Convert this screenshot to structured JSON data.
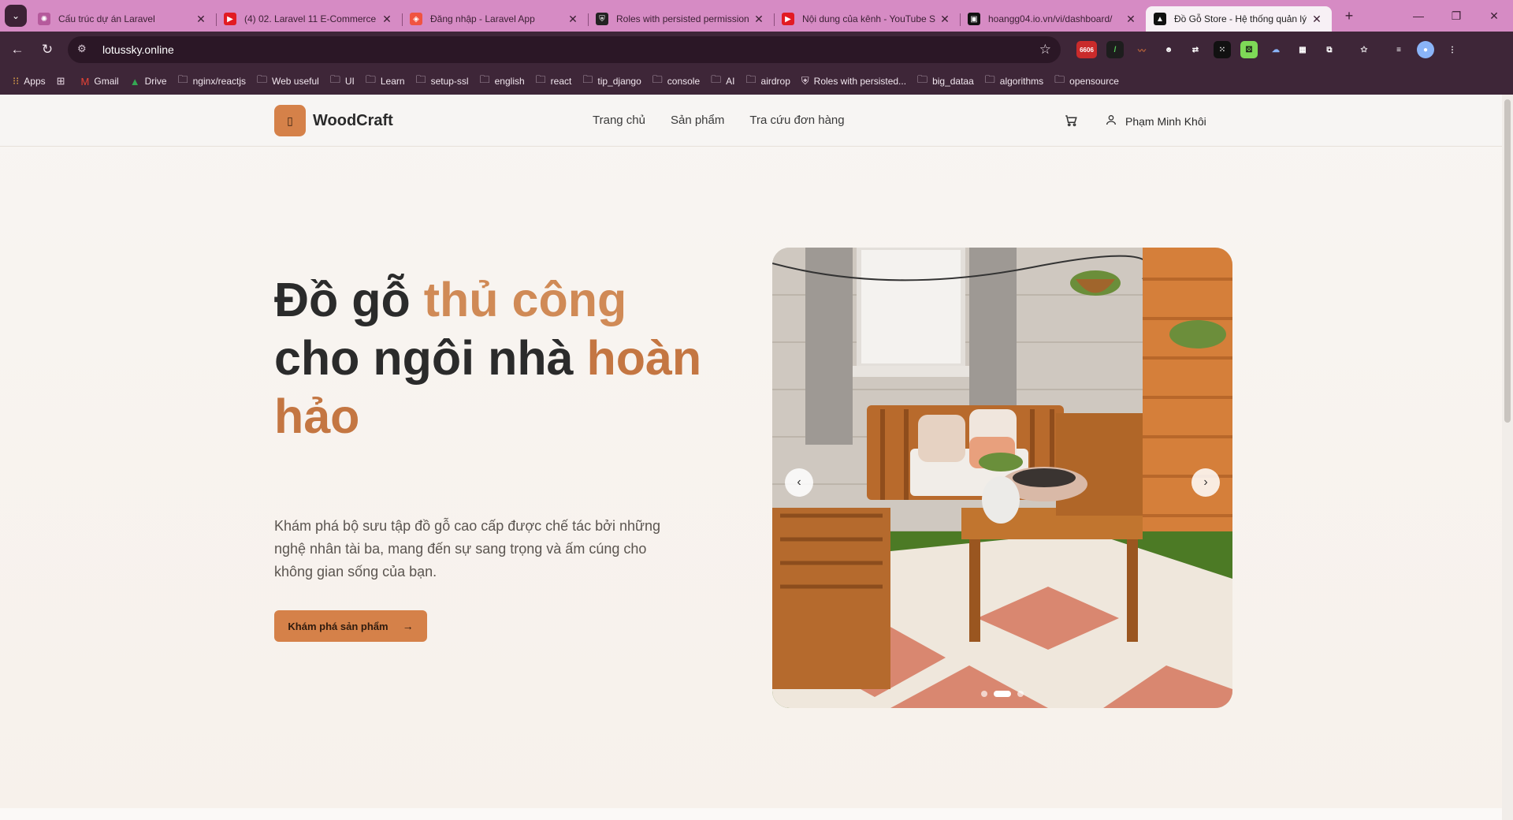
{
  "browser": {
    "tabs": [
      {
        "title": "Cấu trúc dự án Laravel",
        "icon": "openai-icon",
        "color": "#7a4a6f"
      },
      {
        "title": "(4) 02. Laravel 11 E-Commerce",
        "icon": "youtube-icon",
        "color": "#e21b23"
      },
      {
        "title": "Đăng nhập - Laravel App",
        "icon": "laravel-icon",
        "color": "#f05340"
      },
      {
        "title": "Roles with persisted permission",
        "icon": "shield-icon",
        "color": "#222222"
      },
      {
        "title": "Nội dung của kênh - YouTube S",
        "icon": "youtube-icon",
        "color": "#e21b23"
      },
      {
        "title": "hoangg04.io.vn/vi/dashboard/",
        "icon": "site-icon",
        "color": "#111111"
      },
      {
        "title": "Đồ Gỗ Store - Hệ thống quản lý",
        "icon": "vercel-icon",
        "color": "#111111",
        "active": true
      }
    ],
    "url": "lotussky.online",
    "bookmarks": [
      "Apps",
      "Gmail",
      "Drive",
      "nginx/reactjs",
      "Web useful",
      "UI",
      "Learn",
      "setup-ssl",
      "english",
      "react",
      "tip_django",
      "console",
      "AI",
      "airdrop",
      "Roles with persisted...",
      "big_dataa",
      "algorithms",
      "opensource"
    ],
    "extension_badge": "6606"
  },
  "site": {
    "brand": "WoodCraft",
    "nav": [
      "Trang chủ",
      "Sản phẩm",
      "Tra cứu đơn hàng"
    ],
    "user_name": "Phạm Minh Khôi",
    "hero": {
      "title_part1": "Đồ gỗ ",
      "title_accent1": "thủ công",
      "title_part2": "cho ngôi nhà ",
      "title_accent2": "hoàn",
      "title_accent3": "hảo",
      "description": "Khám phá bộ sưu tập đồ gỗ cao cấp được chế tác bởi những nghệ nhân tài ba, mang đến sự sang trọng và ấm cúng cho không gian sống của bạn.",
      "cta": "Khám phá sản phẩm"
    },
    "carousel": {
      "slides": 3,
      "active": 1
    },
    "colors": {
      "accent": "#d58149",
      "title_accent": "#d08a56",
      "text": "#2b2b2b"
    }
  }
}
